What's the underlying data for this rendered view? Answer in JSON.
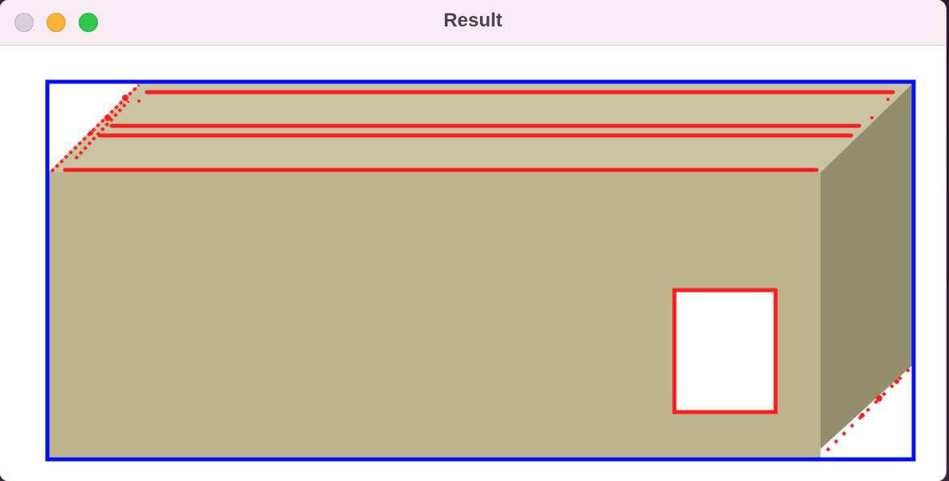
{
  "window": {
    "title": "Result",
    "controls": [
      "close-button",
      "minimize-button",
      "zoom-button"
    ]
  },
  "image": {
    "subject": "box",
    "colors": {
      "detection_box": "#0010ff",
      "detected_lines": "#ff1e1e",
      "front_face": "#bdb58e",
      "top_face": "#c7c3a3",
      "side_face": "#938e6b",
      "window_cutout": "#ffffff"
    }
  }
}
